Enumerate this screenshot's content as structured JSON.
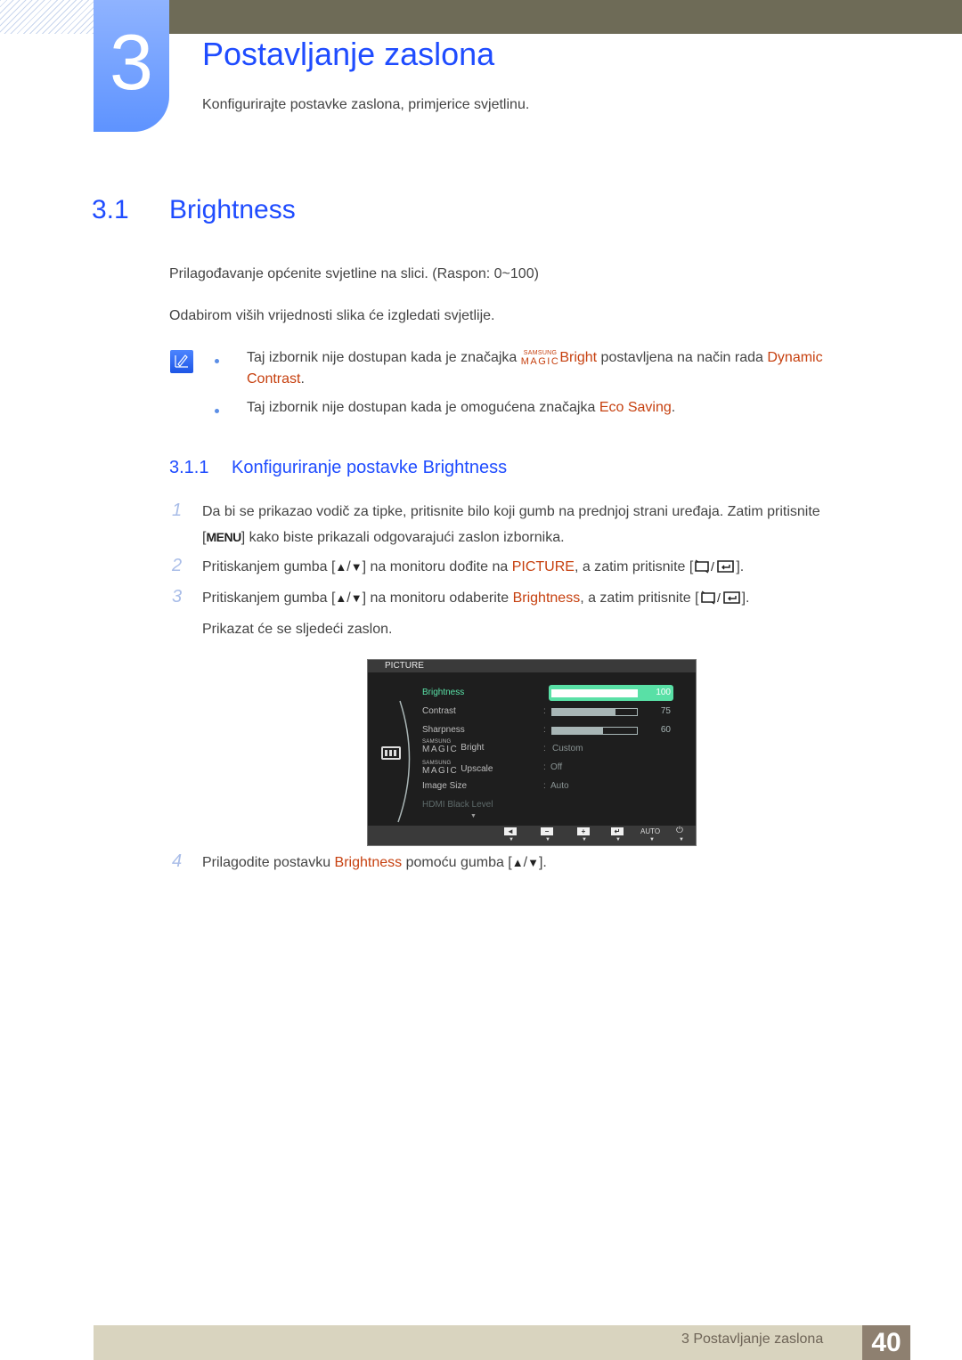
{
  "chapter": {
    "number": "3",
    "title": "Postavljanje zaslona",
    "subtitle": "Konfigurirajte postavke zaslona, primjerice svjetlinu."
  },
  "section": {
    "number": "3.1",
    "title": "Brightness",
    "paragraphs": [
      "Prilagođavanje općenite svjetline na slici. (Raspon: 0~100)",
      "Odabirom viših vrijednosti slika će izgledati svjetlije."
    ]
  },
  "notes": [
    {
      "before": "Taj izbornik nije dostupan kada je značajka ",
      "magic_top": "SAMSUNG",
      "magic_bottom": "MAGIC",
      "highlight1": "Bright",
      "middle": " postavljena na način rada ",
      "highlight2_line1": "Dynamic",
      "highlight2_line2": "Contrast",
      "after": "."
    },
    {
      "before": "Taj izbornik nije dostupan kada je omogućena značajka ",
      "highlight": "Eco Saving",
      "after": "."
    }
  ],
  "subsection": {
    "number": "3.1.1",
    "title": "Konfiguriranje postavke Brightness"
  },
  "steps": [
    {
      "num": "1",
      "line1": "Da bi se prikazao vodič za tipke, pritisnite bilo koji gumb na prednjoj strani uređaja. Zatim pritisnite",
      "key": "MENU",
      "line2": " kako biste prikazali odgovarajući zaslon izbornika."
    },
    {
      "num": "2",
      "before": "Pritiskanjem gumba [",
      "mid": "] na monitoru dođite na ",
      "highlight": "PICTURE",
      "after": ", a zatim pritisnite ["
    },
    {
      "num": "3",
      "before": "Pritiskanjem gumba [",
      "mid": "] na monitoru odaberite ",
      "highlight": "Brightness",
      "after": ", a zatim pritisnite [",
      "line2": "Prikazat će se sljedeći zaslon."
    },
    {
      "num": "4",
      "before": "Prilagodite postavku ",
      "highlight": "Brightness",
      "after": " pomoću gumba ["
    }
  ],
  "symbols": {
    "up": "▲",
    "down": "▼",
    "slash": "/",
    "close_bracket": "]",
    "close_bracket_dot": "].",
    "open_bracket": "[",
    "close_bracket_plain": "]"
  },
  "osd": {
    "header": "PICTURE",
    "items": [
      {
        "label": "Brightness",
        "type": "bar",
        "value": 100,
        "display": "100",
        "active": true
      },
      {
        "label": "Contrast",
        "type": "bar",
        "value": 75,
        "display": "75"
      },
      {
        "label": "Sharpness",
        "type": "bar",
        "value": 60,
        "display": "60"
      },
      {
        "magic_top": "SAMSUNG",
        "magic_bottom": "MAGIC",
        "label": "Bright",
        "type": "option",
        "display": "Custom"
      },
      {
        "magic_top": "SAMSUNG",
        "magic_bottom": "MAGIC",
        "label": "Upscale",
        "type": "option",
        "display": "Off"
      },
      {
        "label": "Image Size",
        "type": "option",
        "display": "Auto"
      },
      {
        "label": "HDMI Black Level",
        "type": "disabled"
      }
    ],
    "colon": ":",
    "more_arrow": "▼",
    "buttons": [
      {
        "name": "left",
        "glyph": "◄"
      },
      {
        "name": "minus",
        "glyph": "−"
      },
      {
        "name": "plus",
        "glyph": "+"
      },
      {
        "name": "enter",
        "glyph": "↵"
      },
      {
        "name": "auto",
        "glyph": "AUTO"
      },
      {
        "name": "power",
        "glyph": "⏻"
      }
    ],
    "button_arrow": "▼"
  },
  "footer": {
    "label": "3 Postavljanje zaslona",
    "page": "40"
  },
  "colors": {
    "heading_blue": "#1f4cff",
    "highlight_orange": "#c6400f",
    "osd_active_green": "#59e0a6",
    "footer_band": "#d9d4bf",
    "footer_page_bg": "#8e8070",
    "top_bar": "#6e6b57"
  }
}
